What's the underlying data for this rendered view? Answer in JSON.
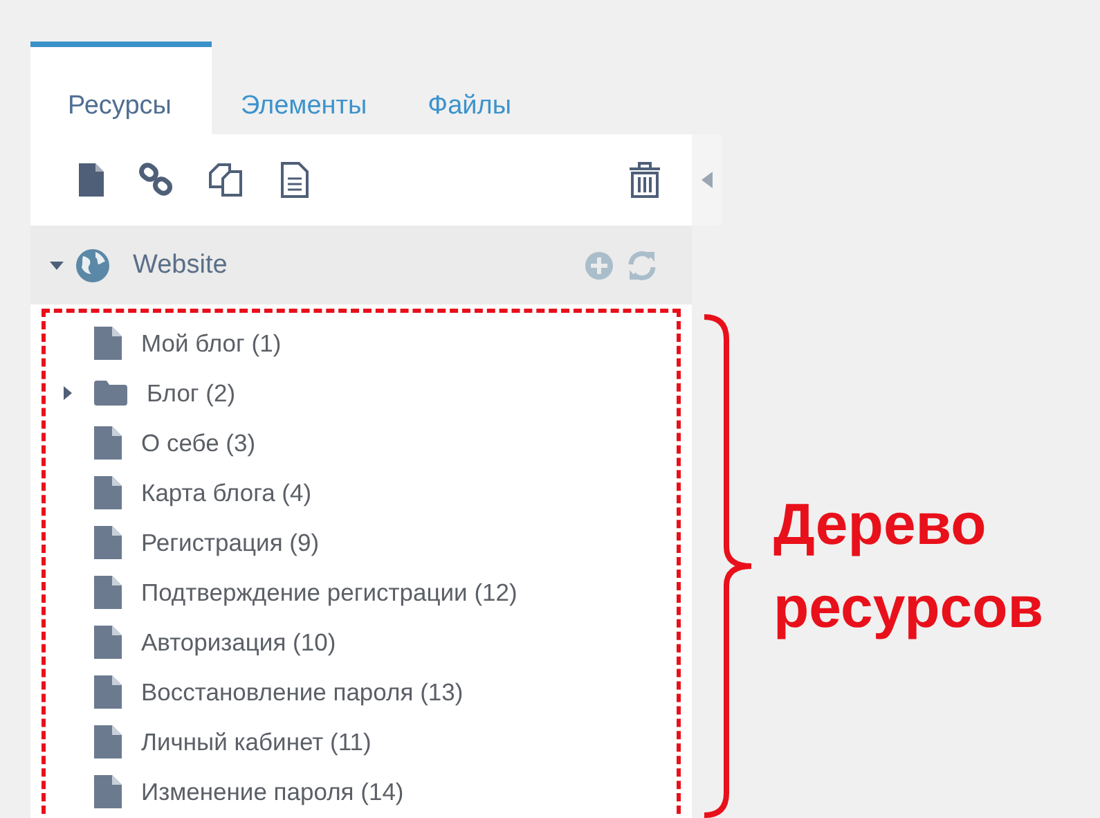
{
  "tabs": [
    {
      "label": "Ресурсы",
      "selected": true
    },
    {
      "label": "Элементы",
      "selected": false
    },
    {
      "label": "Файлы",
      "selected": false
    }
  ],
  "root": {
    "label": "Website",
    "expanded": true
  },
  "tree": [
    {
      "label": "Мой блог (1)",
      "kind": "page"
    },
    {
      "label": "Блог (2)",
      "kind": "folder",
      "expanded": false
    },
    {
      "label": "О себе (3)",
      "kind": "page"
    },
    {
      "label": "Карта блога (4)",
      "kind": "page"
    },
    {
      "label": "Регистрация (9)",
      "kind": "page"
    },
    {
      "label": "Подтверждение регистрации (12)",
      "kind": "page"
    },
    {
      "label": "Авторизация (10)",
      "kind": "page"
    },
    {
      "label": "Восстановление пароля (13)",
      "kind": "page"
    },
    {
      "label": "Личный кабинет (11)",
      "kind": "page"
    },
    {
      "label": "Изменение пароля (14)",
      "kind": "page"
    }
  ],
  "annotation": {
    "lines": [
      "Дерево",
      "ресурсов"
    ]
  }
}
